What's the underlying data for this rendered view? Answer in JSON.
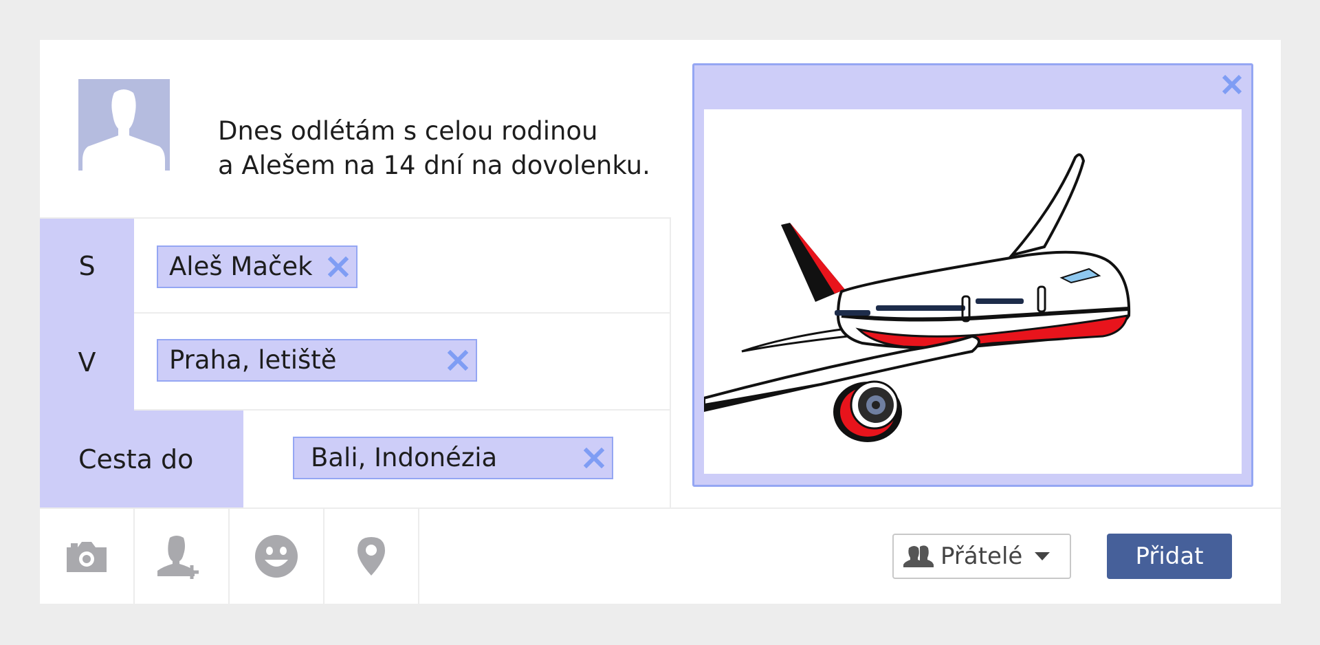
{
  "composer": {
    "status_line_1": "Dnes odlétám s celou rodinou",
    "status_line_2": "a Alešem na 14 dní na dovolenku."
  },
  "tags": {
    "with": {
      "label": "S",
      "value": "Aleš Maček"
    },
    "at": {
      "label": "V",
      "value": "Praha, letiště"
    },
    "travel_to": {
      "label": "Cesta do",
      "value": "Bali, Indonézia"
    }
  },
  "preview": {
    "image": "airplane-illustration",
    "close_icon": "close-icon"
  },
  "footer": {
    "tools": [
      "camera-icon",
      "tag-friend-icon",
      "smiley-icon",
      "location-pin-icon"
    ],
    "audience_label": "Přátelé",
    "post_label": "Přidat"
  },
  "colors": {
    "accent_light": "#cdcdf8",
    "accent_border": "#94a6f3",
    "post_button": "#46609a",
    "icon_gray": "#a9a9ad"
  }
}
